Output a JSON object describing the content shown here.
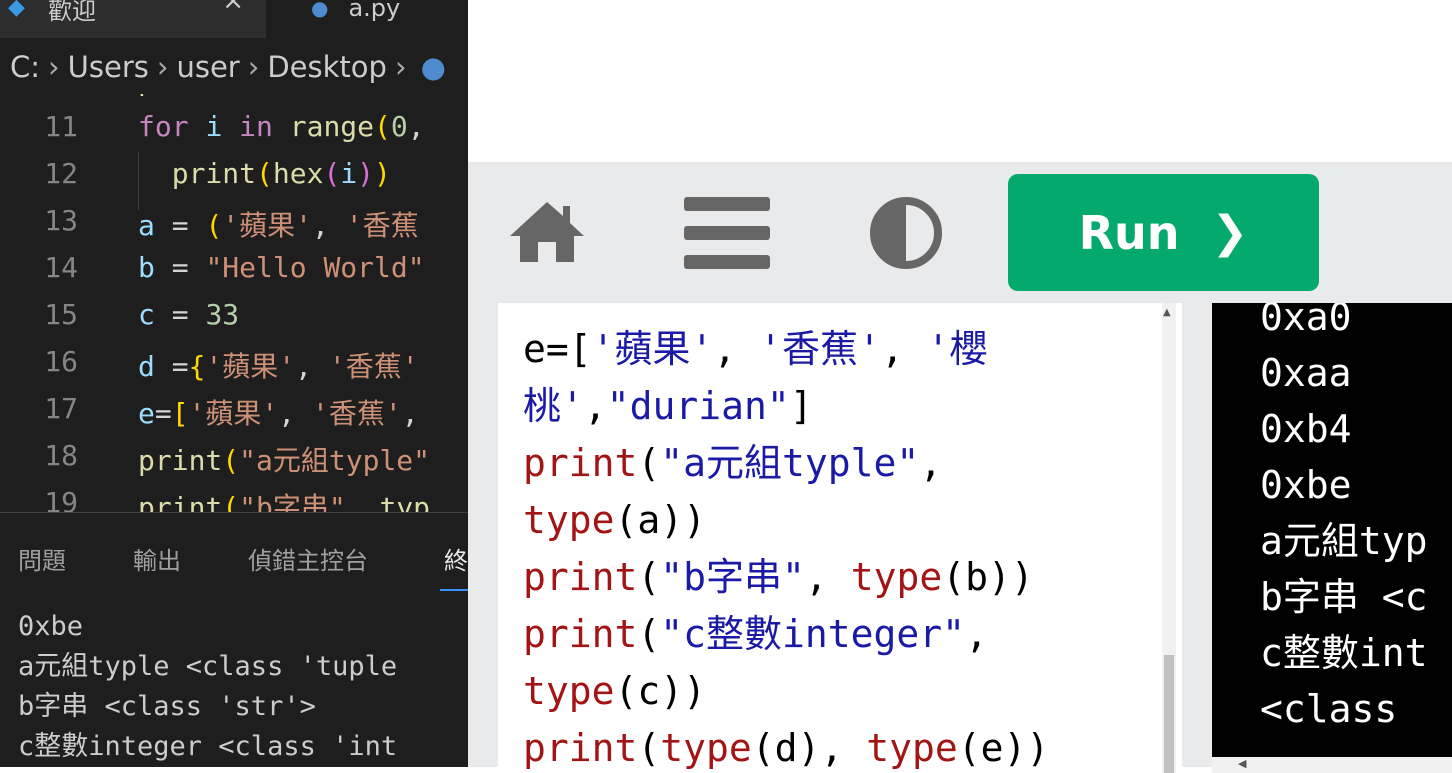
{
  "vscode": {
    "tabs": [
      {
        "label": "歡迎",
        "close": "×"
      },
      {
        "label": "a.py"
      }
    ],
    "breadcrumb": [
      "C:",
      "Users",
      "user",
      "Desktop"
    ],
    "editor_lines": [
      {
        "n": "11"
      },
      {
        "n": "12"
      },
      {
        "n": "13"
      },
      {
        "n": "14"
      },
      {
        "n": "15"
      },
      {
        "n": "16"
      },
      {
        "n": "17"
      },
      {
        "n": "18"
      },
      {
        "n": "19"
      }
    ],
    "panel_tabs": [
      "問題",
      "輸出",
      "偵錯主控台",
      "終"
    ],
    "terminal_lines": [
      "0xbe",
      "a元組typle <class 'tuple",
      "b字串 <class 'str'>",
      "c整數integer <class 'int"
    ]
  },
  "online": {
    "run_label": "Run",
    "run_chevron": "❯",
    "code_lines": [
      "e=['蘋果', '香蕉', '櫻",
      "桃',\"durian\"]",
      "print(\"a元組typle\",",
      "type(a))",
      "print(\"b字串\", type(b))",
      "print(\"c整數integer\",",
      "type(c))",
      "print(type(d), type(e))"
    ],
    "output_lines": [
      "0xa0",
      "0xaa",
      "0xb4",
      "0xbe",
      "a元組typ",
      "b字串 <c",
      "c整數int",
      "<class"
    ]
  },
  "icons": {
    "home": "home-icon",
    "menu": "menu-icon",
    "contrast": "contrast-icon",
    "vscode": "vscode-logo-icon",
    "python": "python-file-icon"
  },
  "colors": {
    "run": "#04a96d",
    "toolbar_bg": "#e9eaec",
    "icon_gray": "#666666"
  }
}
